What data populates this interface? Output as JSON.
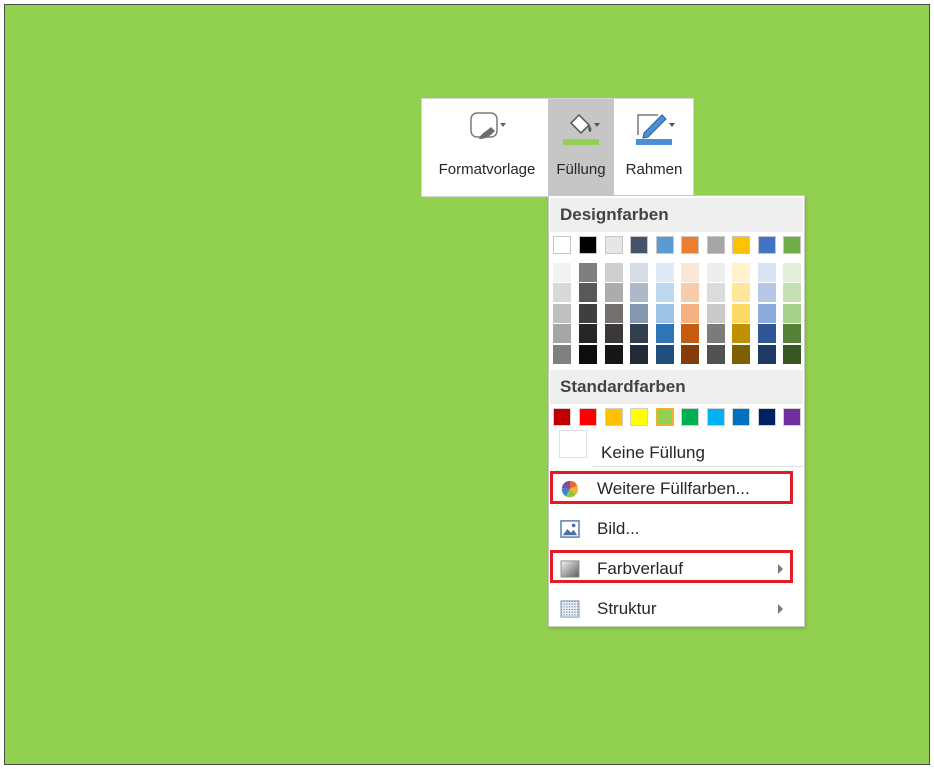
{
  "ribbon": {
    "style_label": "Formatvorlage",
    "fill_label": "Füllung",
    "outline_label": "Rahmen",
    "fill_color": "#92d050",
    "outline_color": "#4a90d9"
  },
  "menu": {
    "theme_colors_heading": "Designfarben",
    "standard_colors_heading": "Standardfarben",
    "theme_colors": [
      [
        "#ffffff",
        "#f2f2f2",
        "#d9d9d9",
        "#bfbfbf",
        "#a6a6a6",
        "#808080"
      ],
      [
        "#000000",
        "#7f7f7f",
        "#595959",
        "#3f3f3f",
        "#262626",
        "#0d0d0d"
      ],
      [
        "#e7e6e6",
        "#d0cece",
        "#aeabab",
        "#757070",
        "#3a3838",
        "#171616"
      ],
      [
        "#44546a",
        "#d6dce4",
        "#adb9ca",
        "#8497b0",
        "#333f4f",
        "#222a35"
      ],
      [
        "#5b9bd5",
        "#deebf6",
        "#bdd7ee",
        "#9dc3e6",
        "#2e75b5",
        "#1e4e79"
      ],
      [
        "#ed7d31",
        "#fbe5d5",
        "#f7cbac",
        "#f4b183",
        "#c55a11",
        "#843c0b"
      ],
      [
        "#a5a5a5",
        "#ededed",
        "#dbdbdb",
        "#c9c9c9",
        "#7b7b7b",
        "#525252"
      ],
      [
        "#ffc000",
        "#fff2cc",
        "#ffe699",
        "#ffd965",
        "#bf9000",
        "#7f6000"
      ],
      [
        "#4472c4",
        "#dae3f3",
        "#b4c7e7",
        "#8faadc",
        "#2f5597",
        "#1f3864"
      ],
      [
        "#70ad47",
        "#e2efd9",
        "#c5e0b3",
        "#a8d08d",
        "#538135",
        "#375623"
      ]
    ],
    "standard_colors": [
      "#c00000",
      "#ff0000",
      "#ffc000",
      "#ffff00",
      "#92d050",
      "#00b050",
      "#00b0f0",
      "#0070c0",
      "#002060",
      "#7030a0"
    ],
    "selected_standard_index": 4,
    "items": {
      "no_fill": "Keine Füllung",
      "more_colors": "Weitere Füllfarben...",
      "picture": "Bild...",
      "gradient": "Farbverlauf",
      "texture": "Struktur"
    },
    "icons": {
      "no_fill": "empty-square-icon",
      "more_colors": "color-wheel-icon",
      "picture": "picture-icon",
      "gradient": "gradient-icon",
      "texture": "texture-icon"
    }
  }
}
